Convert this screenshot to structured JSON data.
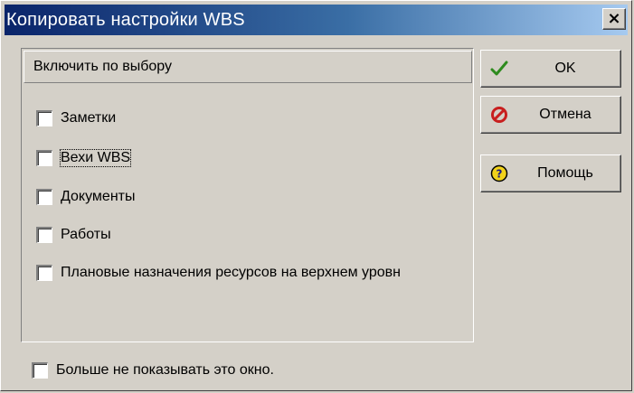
{
  "window": {
    "title": "Копировать настройки WBS",
    "close_label": "×"
  },
  "group": {
    "header": "Включить по выбору",
    "options": [
      {
        "label": "Заметки",
        "checked": false
      },
      {
        "label": "Вехи WBS",
        "checked": false,
        "focused": true
      },
      {
        "label": "Документы",
        "checked": false
      },
      {
        "label": "Работы",
        "checked": false
      },
      {
        "label": "Плановые назначения ресурсов на верхнем уровн",
        "checked": false
      }
    ]
  },
  "buttons": {
    "ok": {
      "label": "OK",
      "icon": "checkmark-icon",
      "color": "#2e8b1e"
    },
    "cancel": {
      "label": "Отмена",
      "icon": "cancel-icon",
      "color": "#c81e1e"
    },
    "help": {
      "label": "Помощь",
      "icon": "help-icon",
      "color": "#f2d21a"
    }
  },
  "footer": {
    "dont_show_label": "Больше не показывать это окно.",
    "dont_show_checked": false
  },
  "colors": {
    "title_gradient_start": "#0a246a",
    "title_gradient_end": "#a6caf0",
    "face": "#d4d0c8"
  }
}
